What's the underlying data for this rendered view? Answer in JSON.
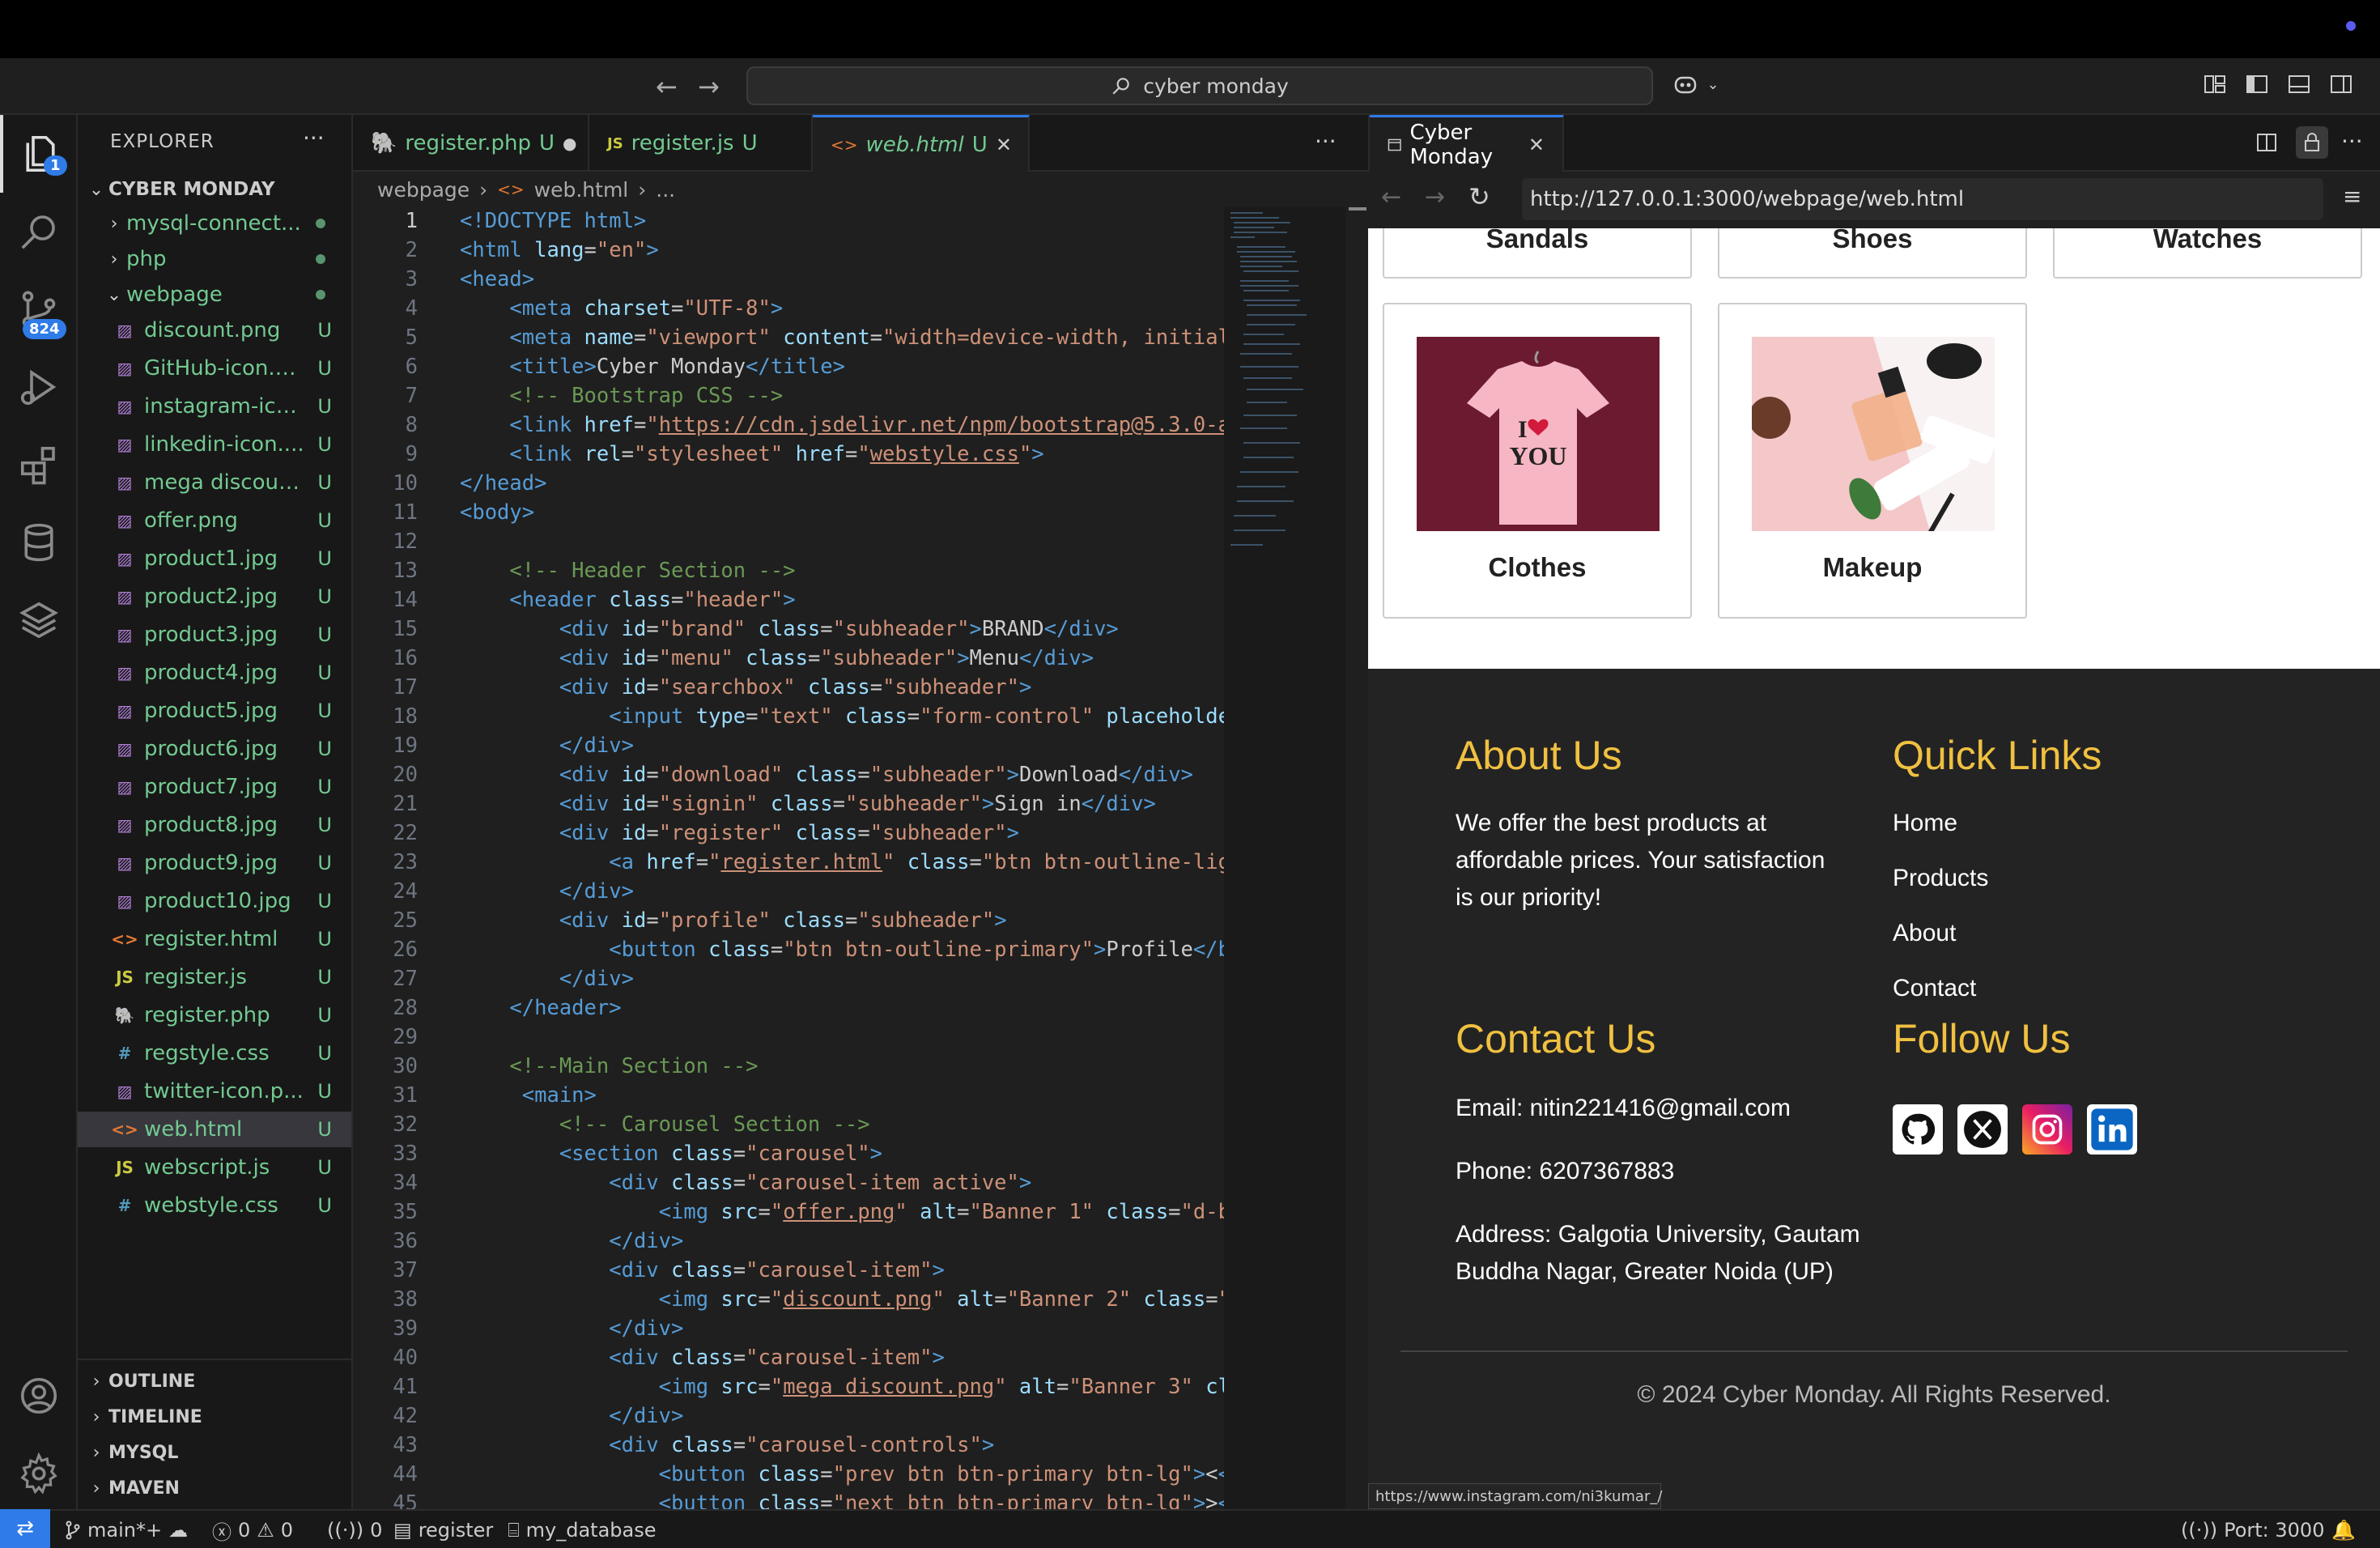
{
  "titlebar": {
    "search_text": "cyber monday"
  },
  "activity_bar": {
    "explorer_badge": "1",
    "scm_badge": "824"
  },
  "explorer": {
    "title": "EXPLORER",
    "root": "CYBER MONDAY",
    "folders": [
      {
        "label": "mysql-connect..."
      },
      {
        "label": "php"
      },
      {
        "label": "webpage"
      }
    ],
    "files": [
      {
        "label": "discount.png",
        "status": "U",
        "icon": "image-icon"
      },
      {
        "label": "GitHub-icon.p...",
        "status": "U",
        "icon": "image-icon"
      },
      {
        "label": "instagram-ico...",
        "status": "U",
        "icon": "image-icon"
      },
      {
        "label": "linkedin-icon....",
        "status": "U",
        "icon": "image-icon"
      },
      {
        "label": "mega discoun...",
        "status": "U",
        "icon": "image-icon"
      },
      {
        "label": "offer.png",
        "status": "U",
        "icon": "image-icon"
      },
      {
        "label": "product1.jpg",
        "status": "U",
        "icon": "image-icon"
      },
      {
        "label": "product2.jpg",
        "status": "U",
        "icon": "image-icon"
      },
      {
        "label": "product3.jpg",
        "status": "U",
        "icon": "image-icon"
      },
      {
        "label": "product4.jpg",
        "status": "U",
        "icon": "image-icon"
      },
      {
        "label": "product5.jpg",
        "status": "U",
        "icon": "image-icon"
      },
      {
        "label": "product6.jpg",
        "status": "U",
        "icon": "image-icon"
      },
      {
        "label": "product7.jpg",
        "status": "U",
        "icon": "image-icon"
      },
      {
        "label": "product8.jpg",
        "status": "U",
        "icon": "image-icon"
      },
      {
        "label": "product9.jpg",
        "status": "U",
        "icon": "image-icon"
      },
      {
        "label": "product10.jpg",
        "status": "U",
        "icon": "image-icon"
      },
      {
        "label": "register.html",
        "status": "U",
        "icon": "html-icon"
      },
      {
        "label": "register.js",
        "status": "U",
        "icon": "js-icon"
      },
      {
        "label": "register.php",
        "status": "U",
        "icon": "php-icon"
      },
      {
        "label": "regstyle.css",
        "status": "U",
        "icon": "css-icon"
      },
      {
        "label": "twitter-icon.p...",
        "status": "U",
        "icon": "image-icon"
      },
      {
        "label": "web.html",
        "status": "U",
        "icon": "html-icon"
      },
      {
        "label": "webscript.js",
        "status": "U",
        "icon": "js-icon"
      },
      {
        "label": "webstyle.css",
        "status": "U",
        "icon": "css-icon"
      }
    ],
    "sections": [
      "OUTLINE",
      "TIMELINE",
      "MYSQL",
      "MAVEN"
    ]
  },
  "editor": {
    "tabs": [
      {
        "label": "register.php",
        "status": "U",
        "icon": "php-icon"
      },
      {
        "label": "register.js",
        "status": "U",
        "icon": "js-icon"
      },
      {
        "label": "web.html",
        "status": "U",
        "icon": "html-icon"
      }
    ],
    "breadcrumb": [
      "webpage",
      "web.html",
      "..."
    ]
  },
  "preview": {
    "tab_title": "Cyber Monday",
    "url": "http://127.0.0.1:3000/webpage/web.html",
    "partial_categories": [
      "Sandals",
      "Shoes",
      "Watches"
    ],
    "categories": [
      {
        "label": "Clothes",
        "tshirt_text_1": "I",
        "tshirt_text_2": "YOU"
      },
      {
        "label": "Makeup"
      }
    ],
    "footer": {
      "about_heading": "About Us",
      "about_text": "We offer the best products at affordable prices. Your satisfaction is our priority!",
      "links_heading": "Quick Links",
      "links": [
        "Home",
        "Products",
        "About",
        "Contact"
      ],
      "contact_heading": "Contact Us",
      "email": "Email: nitin221416@gmail.com",
      "phone": "Phone: 6207367883",
      "address": "Address: Galgotia University, Gautam Buddha Nagar, Greater Noida (UP)",
      "follow_heading": "Follow Us",
      "copyright": "© 2024 Cyber Monday. All Rights Reserved."
    },
    "status_link": "https://www.instagram.com/ni3kumar_/"
  },
  "statusbar": {
    "branch": "main*+",
    "errors": "0",
    "warnings": "0",
    "ports_count": "0",
    "db_connection": "register",
    "database": "my_database",
    "port": "Port: 3000"
  },
  "colors": {
    "accent": "#2f7be8",
    "footer_heading": "#f0c040",
    "untracked": "#73c991"
  }
}
